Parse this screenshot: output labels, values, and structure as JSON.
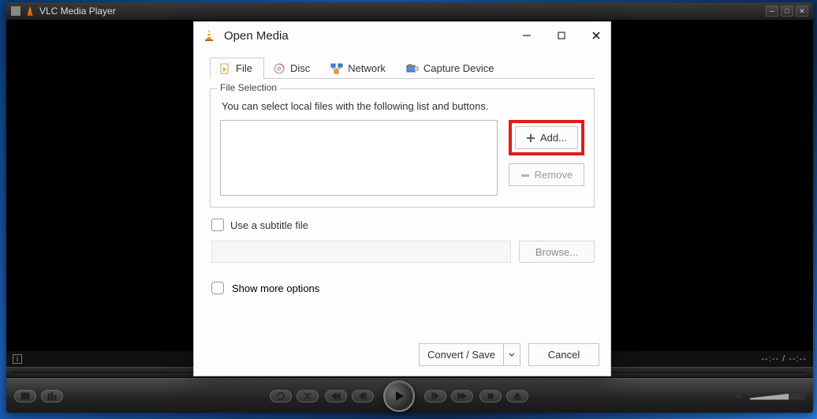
{
  "window": {
    "title": "VLC Media Player",
    "time_left": "--:--",
    "time_right": "--:--"
  },
  "dialog": {
    "title": "Open Media",
    "tabs": {
      "file": "File",
      "disc": "Disc",
      "network": "Network",
      "capture": "Capture Device"
    },
    "file_selection_legend": "File Selection",
    "help_text": "You can select local files with the following list and buttons.",
    "add_label": "Add...",
    "remove_label": "Remove",
    "subtitle_label": "Use a subtitle file",
    "browse_label": "Browse...",
    "show_more_label": "Show more options",
    "convert_label": "Convert / Save",
    "cancel_label": "Cancel"
  }
}
